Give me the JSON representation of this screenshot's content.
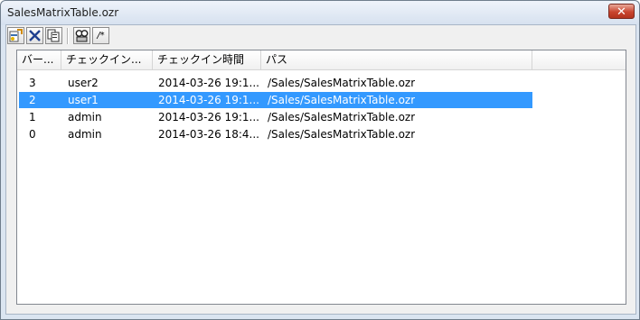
{
  "window": {
    "title": "SalesMatrixTable.ozr",
    "close_glyph": "✕"
  },
  "toolbar": {
    "buttons": [
      {
        "icon": "checkout-icon",
        "glyph": "🗎"
      },
      {
        "icon": "delete-icon",
        "glyph": "✕"
      },
      {
        "icon": "copy-icon",
        "glyph": "⧉"
      },
      {
        "icon": "compare-icon",
        "glyph": "⚲"
      },
      {
        "icon": "comment-icon",
        "glyph": "/*"
      }
    ]
  },
  "listview": {
    "columns": [
      "バー...",
      "チェックイン...",
      "チェックイン時間",
      "パス"
    ],
    "rows": [
      {
        "version": "3",
        "user": "user2",
        "time": "2014-03-26 19:1...",
        "path": "/Sales/SalesMatrixTable.ozr",
        "selected": false
      },
      {
        "version": "2",
        "user": "user1",
        "time": "2014-03-26 19:1...",
        "path": "/Sales/SalesMatrixTable.ozr",
        "selected": true
      },
      {
        "version": "1",
        "user": "admin",
        "time": "2014-03-26 19:1...",
        "path": "/Sales/SalesMatrixTable.ozr",
        "selected": false
      },
      {
        "version": "0",
        "user": "admin",
        "time": "2014-03-26 18:4...",
        "path": "/Sales/SalesMatrixTable.ozr",
        "selected": false
      }
    ]
  },
  "colors": {
    "selection": "#3399ff",
    "close_button": "#c9452f"
  }
}
